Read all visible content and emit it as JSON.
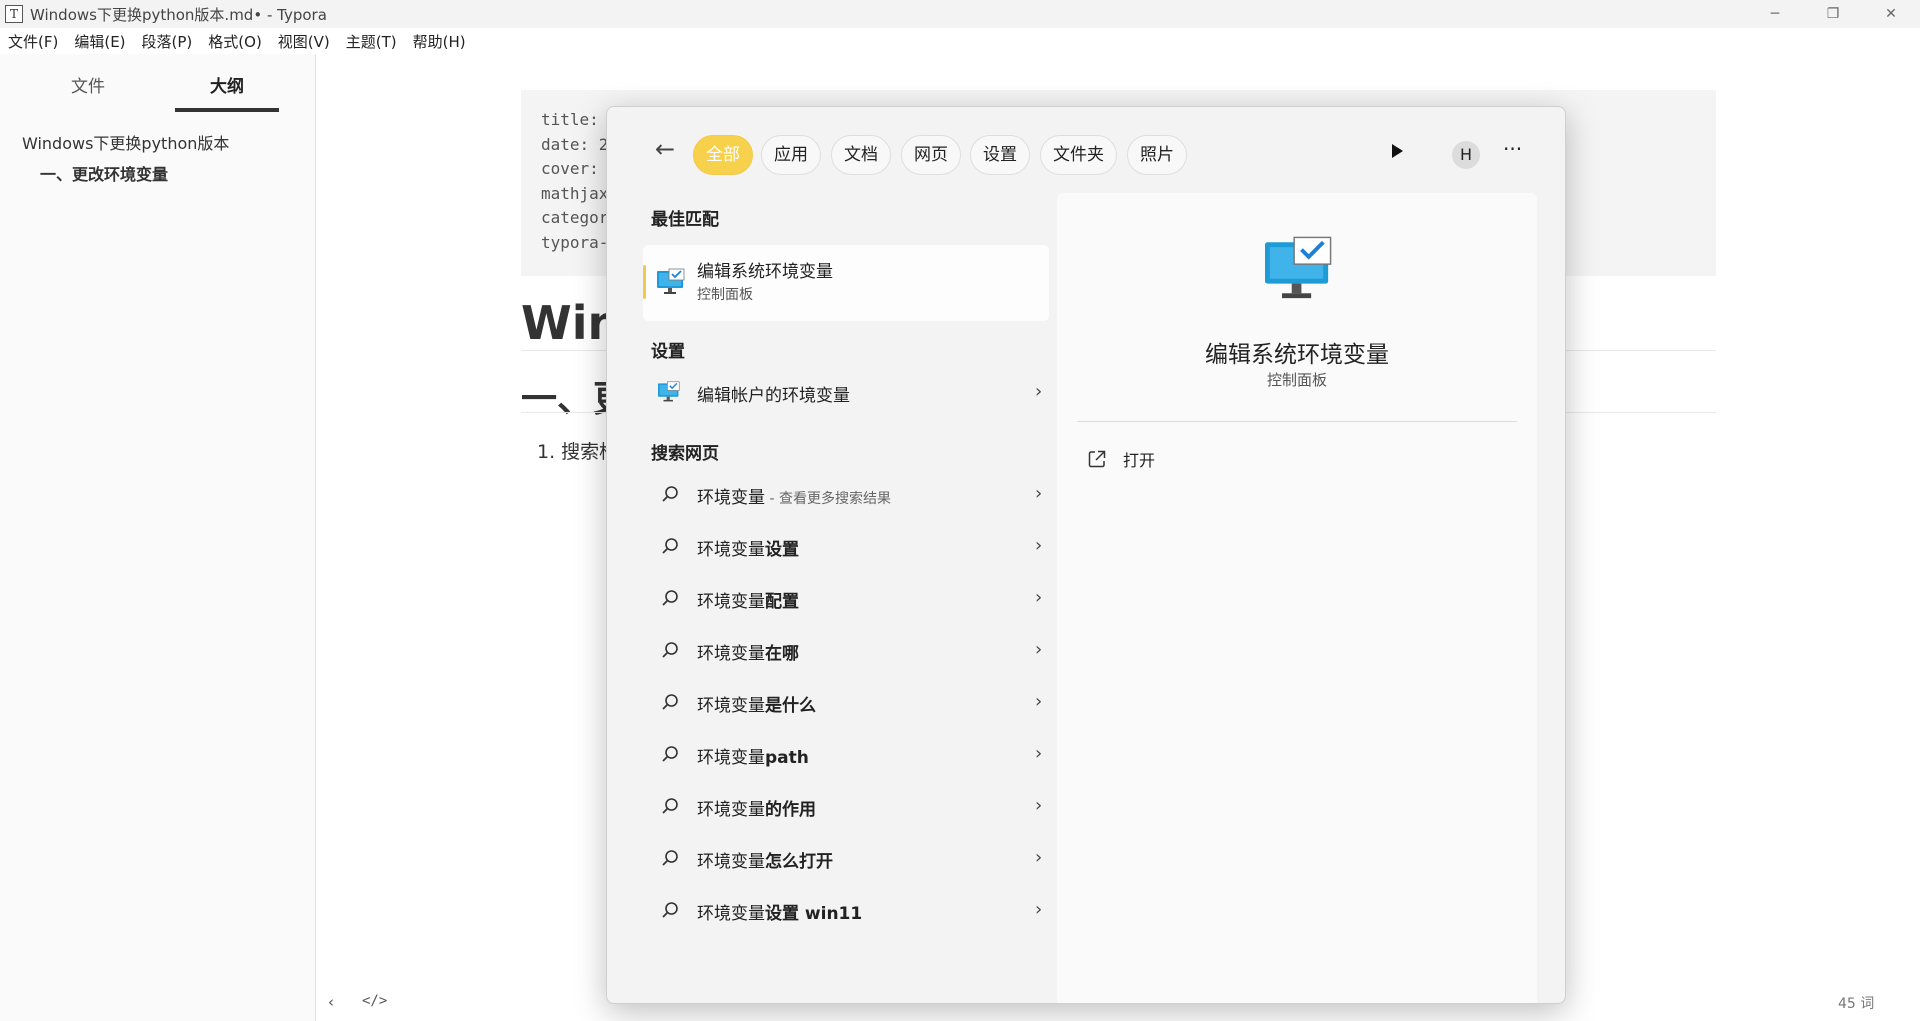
{
  "window": {
    "title": "Windows下更换python版本.md• - Typora",
    "app_icon_glyph": "T",
    "controls": {
      "minimize": "─",
      "maximize": "❐",
      "close": "✕"
    }
  },
  "menubar": [
    "文件(F)",
    "编辑(E)",
    "段落(P)",
    "格式(O)",
    "视图(V)",
    "主题(T)",
    "帮助(H)"
  ],
  "sidebar": {
    "tabs": {
      "files": "文件",
      "outline": "大纲"
    },
    "outline": {
      "h1": "Windows下更换python版本",
      "h2": "一、更改环境变量"
    }
  },
  "editor": {
    "frontmatter": [
      "title:",
      "date: 2",
      "cover:",
      "mathjax",
      "categor",
      "typora-"
    ],
    "h1": "Win",
    "h2": "一、更",
    "list_item": "1. 搜索框"
  },
  "statusbar": {
    "back": "‹",
    "source_toggle": "</>",
    "word_count": "45 词"
  },
  "search": {
    "back_icon": "←",
    "filters": [
      "全部",
      "应用",
      "文档",
      "网页",
      "设置",
      "文件夹",
      "照片"
    ],
    "avatar_letter": "H",
    "more": "···",
    "best_match": {
      "header": "最佳匹配",
      "title": "编辑系统环境变量",
      "subtitle": "控制面板"
    },
    "settings": {
      "header": "设置",
      "item": "编辑帐户的环境变量"
    },
    "web": {
      "header": "搜索网页",
      "first": {
        "prefix": "环境变量",
        "hint": " - 查看更多搜索结果"
      },
      "prefix": "环境变量",
      "suggestions": [
        "设置",
        "配置",
        "在哪",
        "是什么",
        "path",
        "的作用",
        "怎么打开",
        "设置 win11"
      ]
    },
    "chevron": "›",
    "detail": {
      "title": "编辑系统环境变量",
      "subtitle": "控制面板",
      "action": "打开"
    },
    "accent_color": "#f7d04c"
  }
}
